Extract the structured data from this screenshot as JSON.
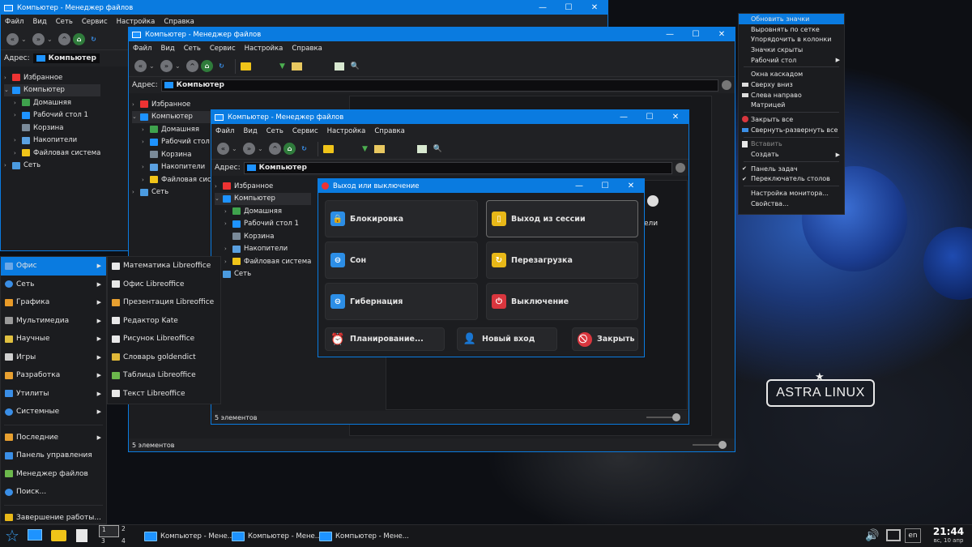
{
  "window_title": "Компьютер - Менеджер файлов",
  "menu": [
    "Файл",
    "Вид",
    "Сеть",
    "Сервис",
    "Настройка",
    "Справка"
  ],
  "address_label": "Адрес:",
  "address_value": "Компьютер",
  "tree": {
    "favorites": "Избранное",
    "computer": "Компьютер",
    "home": "Домашняя",
    "desktop": "Рабочий стол 1",
    "desktop_short": "Рабочий стол",
    "desktop_cut": "Рабочий стол",
    "trash": "Корзина",
    "drives": "Накопители",
    "fs": "Файловая система",
    "fs_cut": "Файловая систе",
    "network": "Сеть"
  },
  "status": "5 элементов",
  "start_menu": {
    "items": [
      "Офис",
      "Сеть",
      "Графика",
      "Мультимедиа",
      "Научные",
      "Игры",
      "Разработка",
      "Утилиты",
      "Системные"
    ],
    "recent": "Последние",
    "control": "Панель управления",
    "fm": "Менеджер файлов",
    "search": "Поиск...",
    "shutdown": "Завершение работы..."
  },
  "office_menu": [
    "Математика Libreoffice",
    "Офис Libreoffice",
    "Презентация Libreoffice",
    "Редактор Kate",
    "Рисунок Libreoffice",
    "Словарь goldendict",
    "Таблица Libreoffice",
    "Текст Libreoffice"
  ],
  "context_menu": {
    "g1": [
      "Обновить значки",
      "Выровнять по сетке",
      "Упорядочить в колонки",
      "Значки скрыты",
      "Рабочий стол"
    ],
    "g2": [
      "Окна каскадом",
      "Сверху вниз",
      "Слева направо",
      "Матрицей"
    ],
    "g3": [
      "Закрыть все",
      "Свернуть-развернуть все"
    ],
    "g4": [
      "Вставить",
      "Создать"
    ],
    "g5": [
      "Панель задач",
      "Переключатель столов"
    ],
    "g6": [
      "Настройка монитора...",
      "Свойства..."
    ]
  },
  "dialog": {
    "title": "Выход или выключение",
    "lock": "Блокировка",
    "logout": "Выход из сессии",
    "sleep": "Сон",
    "reboot": "Перезагрузка",
    "hibernate": "Гибернация",
    "poweroff": "Выключение",
    "schedule": "Планирование...",
    "newlogin": "Новый вход",
    "close": "Закрыть"
  },
  "behind_label": "ели",
  "logo": "ASTRA LINUX",
  "taskbar": {
    "tasks": [
      "Компьютер - Мене...",
      "Компьютер - Мене...",
      "Компьютер - Мене..."
    ],
    "desktops": [
      "1",
      "2",
      "3",
      "4"
    ],
    "lang": "en",
    "time": "21:44",
    "date": "вс, 10 апр"
  },
  "colors": {
    "accent": "#0a7be0",
    "bg": "#1c1d20"
  }
}
